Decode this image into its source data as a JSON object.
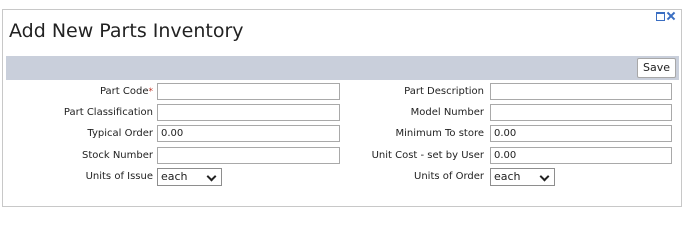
{
  "window": {
    "title": "Add New Parts Inventory",
    "controls": {
      "restore_icon": "restore-icon",
      "close_icon": "close-icon"
    }
  },
  "toolbar": {
    "save_label": "Save"
  },
  "form": {
    "part_code": {
      "label": "Part Code",
      "required_mark": "*",
      "value": ""
    },
    "part_description": {
      "label": "Part Description",
      "value": ""
    },
    "part_classification": {
      "label": "Part Classification",
      "value": ""
    },
    "model_number": {
      "label": "Model Number",
      "value": ""
    },
    "typical_order": {
      "label": "Typical Order",
      "value": "0.00"
    },
    "minimum_to_store": {
      "label": "Minimum To store",
      "value": "0.00"
    },
    "stock_number": {
      "label": "Stock Number",
      "value": ""
    },
    "unit_cost": {
      "label": "Unit Cost - set by User",
      "value": "0.00"
    },
    "units_of_issue": {
      "label": "Units of Issue",
      "selected": "each"
    },
    "units_of_order": {
      "label": "Units of Order",
      "selected": "each"
    }
  },
  "colors": {
    "toolbar_bg": "#c9cfdb",
    "accent_blue": "#3a6ec2",
    "required_red": "#c0392b"
  }
}
